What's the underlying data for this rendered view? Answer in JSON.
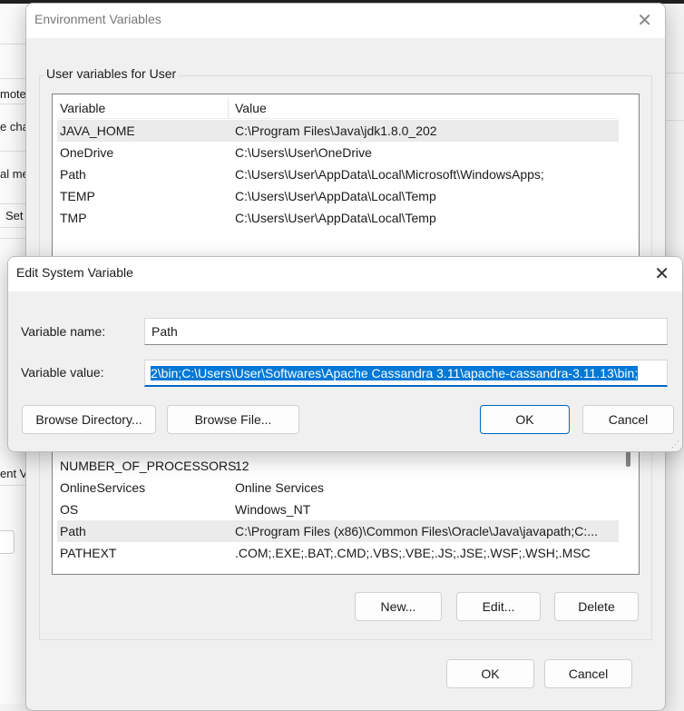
{
  "background": {
    "fragments": [
      "mote",
      "e cha",
      "al me",
      "Set",
      "ent V"
    ]
  },
  "env_dialog": {
    "title": "Environment Variables",
    "user_group_label": "User variables for User",
    "columns": [
      "Variable",
      "Value"
    ],
    "user_vars": [
      {
        "name": "JAVA_HOME",
        "value": "C:\\Program Files\\Java\\jdk1.8.0_202",
        "selected": true
      },
      {
        "name": "OneDrive",
        "value": "C:\\Users\\User\\OneDrive"
      },
      {
        "name": "Path",
        "value": "C:\\Users\\User\\AppData\\Local\\Microsoft\\WindowsApps;"
      },
      {
        "name": "TEMP",
        "value": "C:\\Users\\User\\AppData\\Local\\Temp"
      },
      {
        "name": "TMP",
        "value": "C:\\Users\\User\\AppData\\Local\\Temp"
      }
    ],
    "system_vars": [
      {
        "name": "NUMBER_OF_PROCESSORS",
        "value": "12"
      },
      {
        "name": "OnlineServices",
        "value": "Online Services"
      },
      {
        "name": "OS",
        "value": "Windows_NT"
      },
      {
        "name": "Path",
        "value": "C:\\Program Files (x86)\\Common Files\\Oracle\\Java\\javapath;C:...",
        "selected": true
      },
      {
        "name": "PATHEXT",
        "value": ".COM;.EXE;.BAT;.CMD;.VBS;.VBE;.JS;.JSE;.WSF;.WSH;.MSC"
      }
    ],
    "buttons": {
      "new": "New...",
      "edit": "Edit...",
      "delete": "Delete",
      "ok": "OK",
      "cancel": "Cancel"
    }
  },
  "edit_dialog": {
    "title": "Edit System Variable",
    "name_label": "Variable name:",
    "name_value": "Path",
    "value_label": "Variable value:",
    "value_value": "2\\bin;C:\\Users\\User\\Softwares\\Apache Cassandra 3.11\\apache-cassandra-3.11.13\\bin;",
    "buttons": {
      "browse_dir": "Browse Directory...",
      "browse_file": "Browse File...",
      "ok": "OK",
      "cancel": "Cancel"
    }
  }
}
